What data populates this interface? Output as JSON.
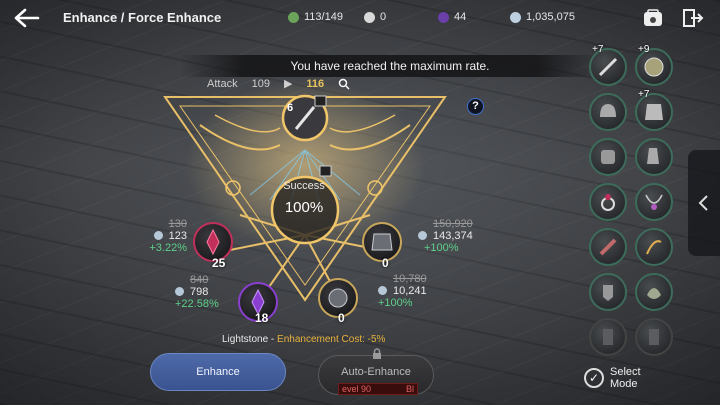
{
  "header": {
    "title": "Enhance / Force Enhance",
    "back_icon": "arrow-left-icon",
    "resources": [
      {
        "name": "inventory",
        "value": "113/149",
        "color": "#6ba35a"
      },
      {
        "name": "pearl",
        "value": "0",
        "color": "#d8d8d8"
      },
      {
        "name": "black-gem",
        "value": "44",
        "color": "#6a3fa8"
      },
      {
        "name": "silver",
        "value": "1,035,075",
        "color": "#bcd0e2"
      }
    ],
    "icons": [
      "inventory-bag-icon",
      "exit-door-icon"
    ]
  },
  "banner": "You have reached the maximum rate.",
  "stat": {
    "label": "Attack",
    "current": "109",
    "arrow": "▶",
    "next": "116"
  },
  "equipment": {
    "level": "6"
  },
  "success": {
    "label": "Success",
    "value": "100%"
  },
  "materials": [
    {
      "name": "lightstone-red",
      "count": "25",
      "old_cost": "130",
      "cost": "123",
      "bonus": "+3.22%",
      "color": "#c0305a"
    },
    {
      "name": "lightstone-purple",
      "count": "18",
      "old_cost": "840",
      "cost": "798",
      "bonus": "+22.58%",
      "color": "#8a3fd0"
    },
    {
      "name": "armor-stone",
      "count": "0",
      "old_cost": "150,920",
      "cost": "143,374",
      "bonus": "+100%",
      "color": "#9aa0a6"
    },
    {
      "name": "weapon-stone",
      "count": "0",
      "old_cost": "10,780",
      "cost": "10,241",
      "bonus": "+100%",
      "color": "#9aa0a6"
    }
  ],
  "footer": {
    "lightstone_label": "Lightstone - ",
    "cost_label": "Enhancement Cost: -5%",
    "enhance_button": "Enhance",
    "auto_button": "Auto-Enhance",
    "auto_level": "evel 90",
    "auto_level_right": "Bl",
    "select_mode": "Select Mode"
  },
  "equipment_grid": [
    {
      "name": "sword",
      "level": "+7"
    },
    {
      "name": "shield",
      "level": "+9"
    },
    {
      "name": "helmet",
      "level": ""
    },
    {
      "name": "chest-armor",
      "level": "+7"
    },
    {
      "name": "gloves",
      "level": ""
    },
    {
      "name": "boots",
      "level": ""
    },
    {
      "name": "ring",
      "level": ""
    },
    {
      "name": "necklace",
      "level": ""
    },
    {
      "name": "earring",
      "level": ""
    },
    {
      "name": "belt",
      "level": ""
    },
    {
      "name": "crest",
      "level": ""
    },
    {
      "name": "artifact",
      "level": ""
    },
    {
      "name": "empty-slot-a",
      "level": ""
    },
    {
      "name": "empty-slot-b",
      "level": ""
    }
  ]
}
